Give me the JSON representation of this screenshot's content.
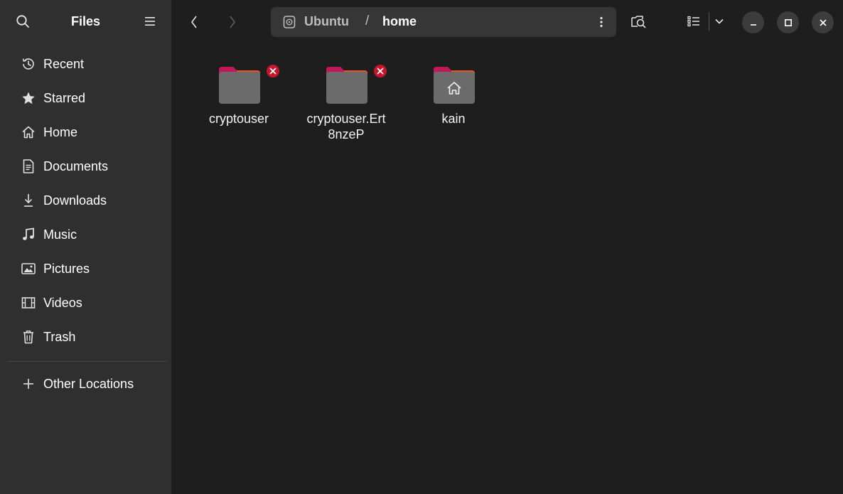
{
  "sidebar": {
    "title": "Files",
    "items": [
      {
        "label": "Recent",
        "icon": "clock-icon"
      },
      {
        "label": "Starred",
        "icon": "star-icon"
      },
      {
        "label": "Home",
        "icon": "home-icon"
      },
      {
        "label": "Documents",
        "icon": "document-icon"
      },
      {
        "label": "Downloads",
        "icon": "download-icon"
      },
      {
        "label": "Music",
        "icon": "music-note-icon"
      },
      {
        "label": "Pictures",
        "icon": "picture-icon"
      },
      {
        "label": "Videos",
        "icon": "film-icon"
      },
      {
        "label": "Trash",
        "icon": "trash-icon"
      }
    ],
    "other_locations": "Other Locations"
  },
  "path": {
    "drive": "Ubuntu",
    "separator": "/",
    "current": "home"
  },
  "files": [
    {
      "name": "cryptouser",
      "icon": "folder-icon",
      "emblem": "unreadable-emblem-icon"
    },
    {
      "name": "cryptouser.Ert8nzeP",
      "icon": "folder-icon",
      "emblem": "unreadable-emblem-icon"
    },
    {
      "name": "kain",
      "icon": "home-folder-icon",
      "emblem": ""
    }
  ],
  "colors": {
    "sidebar_bg": "#2f2f2f",
    "content_bg": "#1e1e1e",
    "folder_tab": "#c2185b",
    "folder_accent": "#e95420",
    "emblem_red": "#c7162b"
  }
}
